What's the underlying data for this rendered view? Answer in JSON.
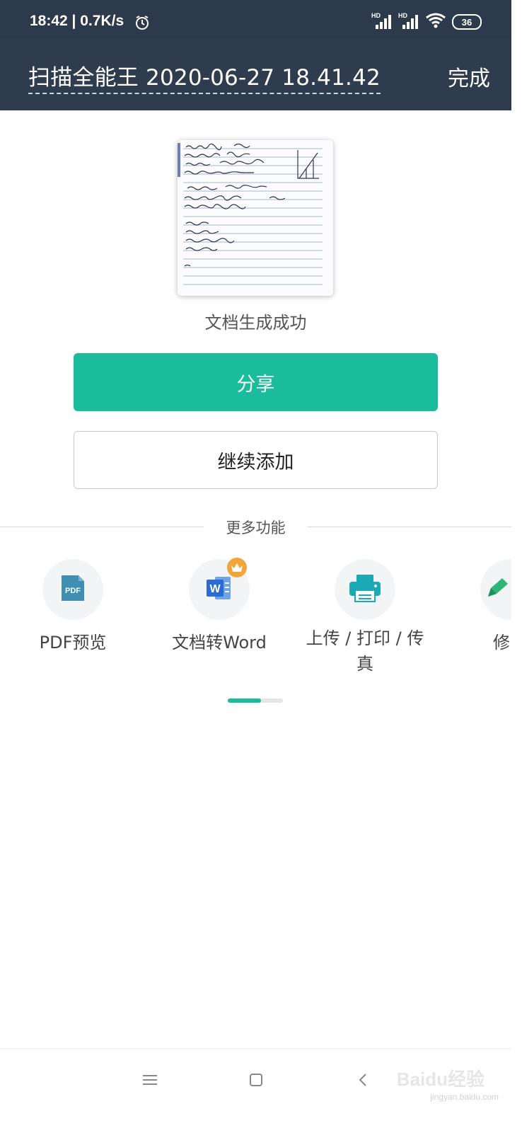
{
  "status_bar": {
    "time": "18:42 | 0.7K/s",
    "signal_badge_1": "HD",
    "signal_badge_2": "HD",
    "battery": "36"
  },
  "header": {
    "title": "扫描全能王 2020-06-27 18.41.42",
    "done_label": "完成"
  },
  "result": {
    "success_text": "文档生成成功"
  },
  "buttons": {
    "share_label": "分享",
    "continue_label": "继续添加"
  },
  "more": {
    "section_label": "更多功能",
    "items": [
      {
        "label": "PDF预览",
        "icon": "pdf-icon"
      },
      {
        "label": "文档转Word",
        "icon": "word-icon"
      },
      {
        "label": "上传 / 打印 / 传真",
        "icon": "printer-icon"
      },
      {
        "label": "修",
        "icon": "pencil-icon"
      }
    ],
    "page_progress": 0.6
  },
  "watermark": {
    "brand": "Baidu经验",
    "url": "jingyan.baidu.com"
  },
  "colors": {
    "header_bg": "#2e3c4e",
    "accent": "#1abc9c",
    "crown": "#f2a53a"
  }
}
